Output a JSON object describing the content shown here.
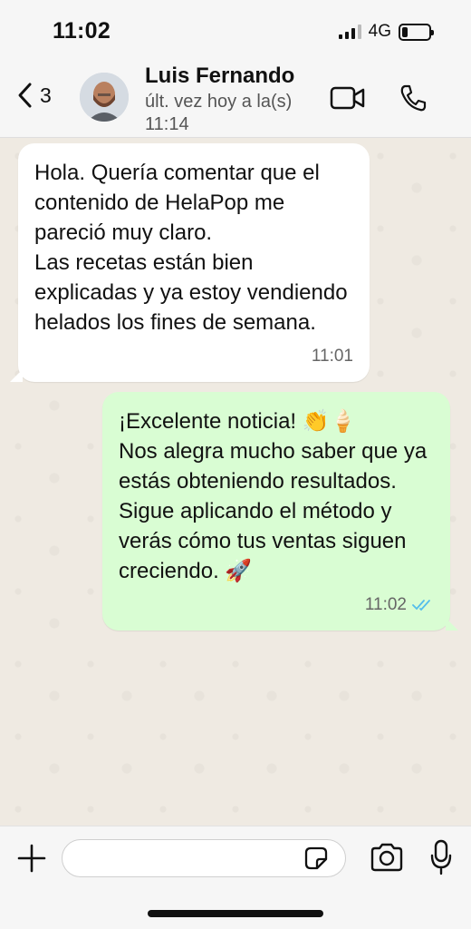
{
  "status_bar": {
    "time": "11:02",
    "network": "4G",
    "battery_level": 0.2
  },
  "header": {
    "back_count": "3",
    "contact_name": "Luis Fernando",
    "contact_status": "últ. vez hoy a la(s) 11:14",
    "icons": [
      "chevron-left-icon",
      "video-camera-icon",
      "phone-icon"
    ]
  },
  "messages": [
    {
      "direction": "incoming",
      "text": "Hola. Quería comentar que el contenido de HelaPop me pareció muy claro.\nLas recetas están bien explicadas y ya estoy vendiendo helados los fines de semana.",
      "time": "11:01"
    },
    {
      "direction": "outgoing",
      "text": "¡Excelente noticia! 👏🍦\nNos alegra mucho saber que ya estás obteniendo resultados. Sigue aplicando el método y verás cómo tus ventas siguen creciendo. 🚀",
      "time": "11:02",
      "read": true
    }
  ],
  "input_bar": {
    "placeholder": "",
    "icons": [
      "plus-icon",
      "sticker-icon",
      "camera-icon",
      "microphone-icon"
    ]
  },
  "colors": {
    "chat_background": "#efeae2",
    "outgoing_bubble": "#d9fdd3",
    "incoming_bubble": "#ffffff",
    "read_ticks": "#53bdeb"
  }
}
